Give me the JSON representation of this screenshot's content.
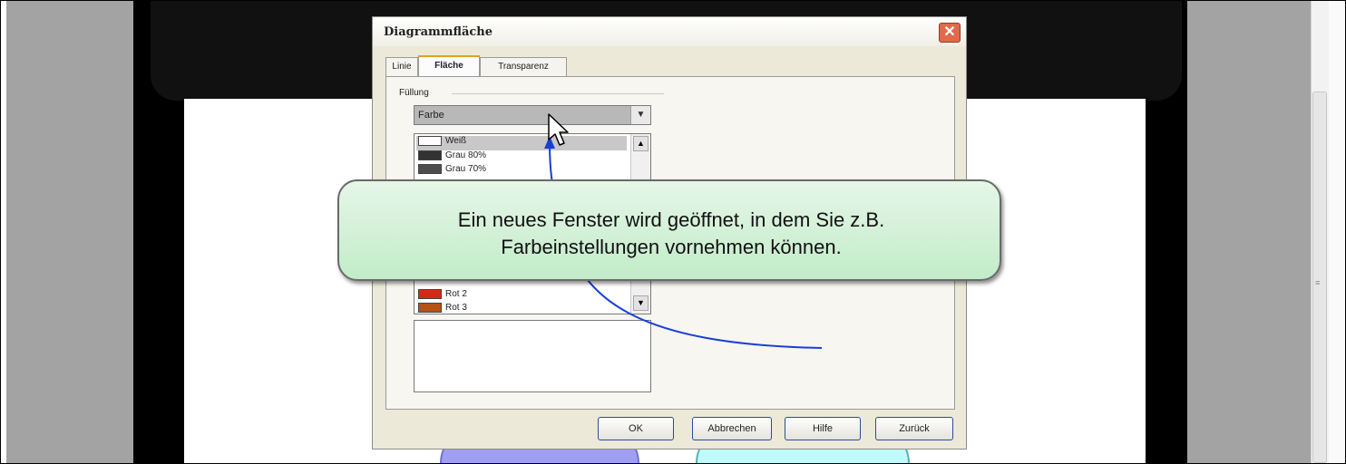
{
  "dialog": {
    "title": "Diagrammfläche",
    "close_symbol": "✕",
    "tabs": [
      {
        "label": "Linie"
      },
      {
        "label": "Fläche"
      },
      {
        "label": "Transparenz"
      }
    ],
    "group_label": "Füllung",
    "fill_select": {
      "value": "Farbe"
    },
    "colors": [
      {
        "name": "Weiß",
        "hex": "#ffffff",
        "selected": true
      },
      {
        "name": "Grau 80%",
        "hex": "#333333"
      },
      {
        "name": "Grau 70%",
        "hex": "#4d4d4d"
      },
      {
        "name": "Rot 2",
        "hex": "#d42a12"
      },
      {
        "name": "Rot 3",
        "hex": "#b55218"
      }
    ],
    "buttons": {
      "ok": "OK",
      "cancel": "Abbrechen",
      "help": "Hilfe",
      "back": "Zurück"
    }
  },
  "callout": {
    "line1": "Ein neues Fenster wird geöffnet, in dem Sie z.B.",
    "line2": "Farbeinstellungen vornehmen können."
  },
  "colors": {
    "callout_fill": "#c9efd0",
    "arrow": "#1a3fd6",
    "close_button": "#e06a4b",
    "side_gray": "#a3a3a3"
  },
  "icons": [
    "close-icon",
    "chevron-down-icon",
    "chevron-up-icon",
    "mouse-cursor-icon",
    "grip-icon"
  ]
}
